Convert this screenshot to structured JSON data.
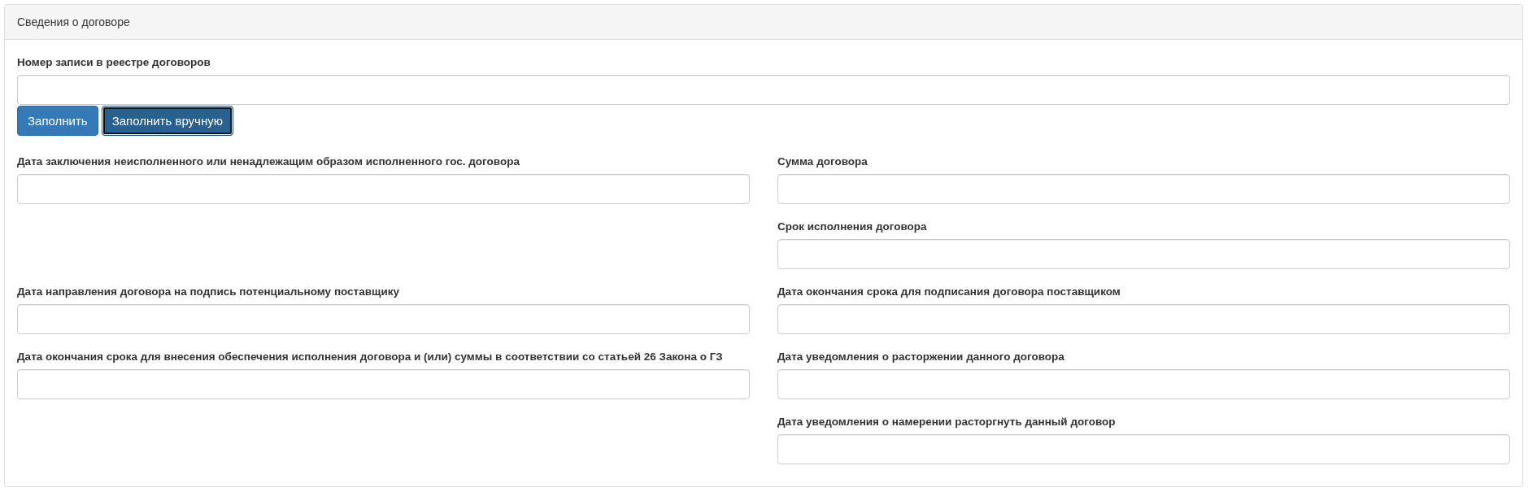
{
  "panel": {
    "title": "Сведения о договоре"
  },
  "registry_field": {
    "label": "Номер записи в реестре договоров"
  },
  "buttons": [
    {
      "label": "Заполнить",
      "focused": false
    },
    {
      "label": "Заполнить вручную",
      "focused": true
    }
  ],
  "left_fields": [
    {
      "label": "Дата заключения неисполненного или ненадлежащим образом исполненного гос. договора"
    },
    {
      "label": "Дата направления договора на подпись потенциальному поставщику"
    },
    {
      "label": "Дата окончания срока для внесения обеспечения исполнения договора и (или) суммы в соответствии со статьей 26 Закона о ГЗ"
    }
  ],
  "right_fields": [
    {
      "label": "Сумма договора"
    },
    {
      "label": "Срок исполнения договора"
    },
    {
      "label": "Дата окончания срока для подписания договора поставщиком"
    },
    {
      "label": "Дата уведомления о расторжении данного договора"
    },
    {
      "label": "Дата уведомления о намерении расторгнуть данный договор"
    }
  ]
}
